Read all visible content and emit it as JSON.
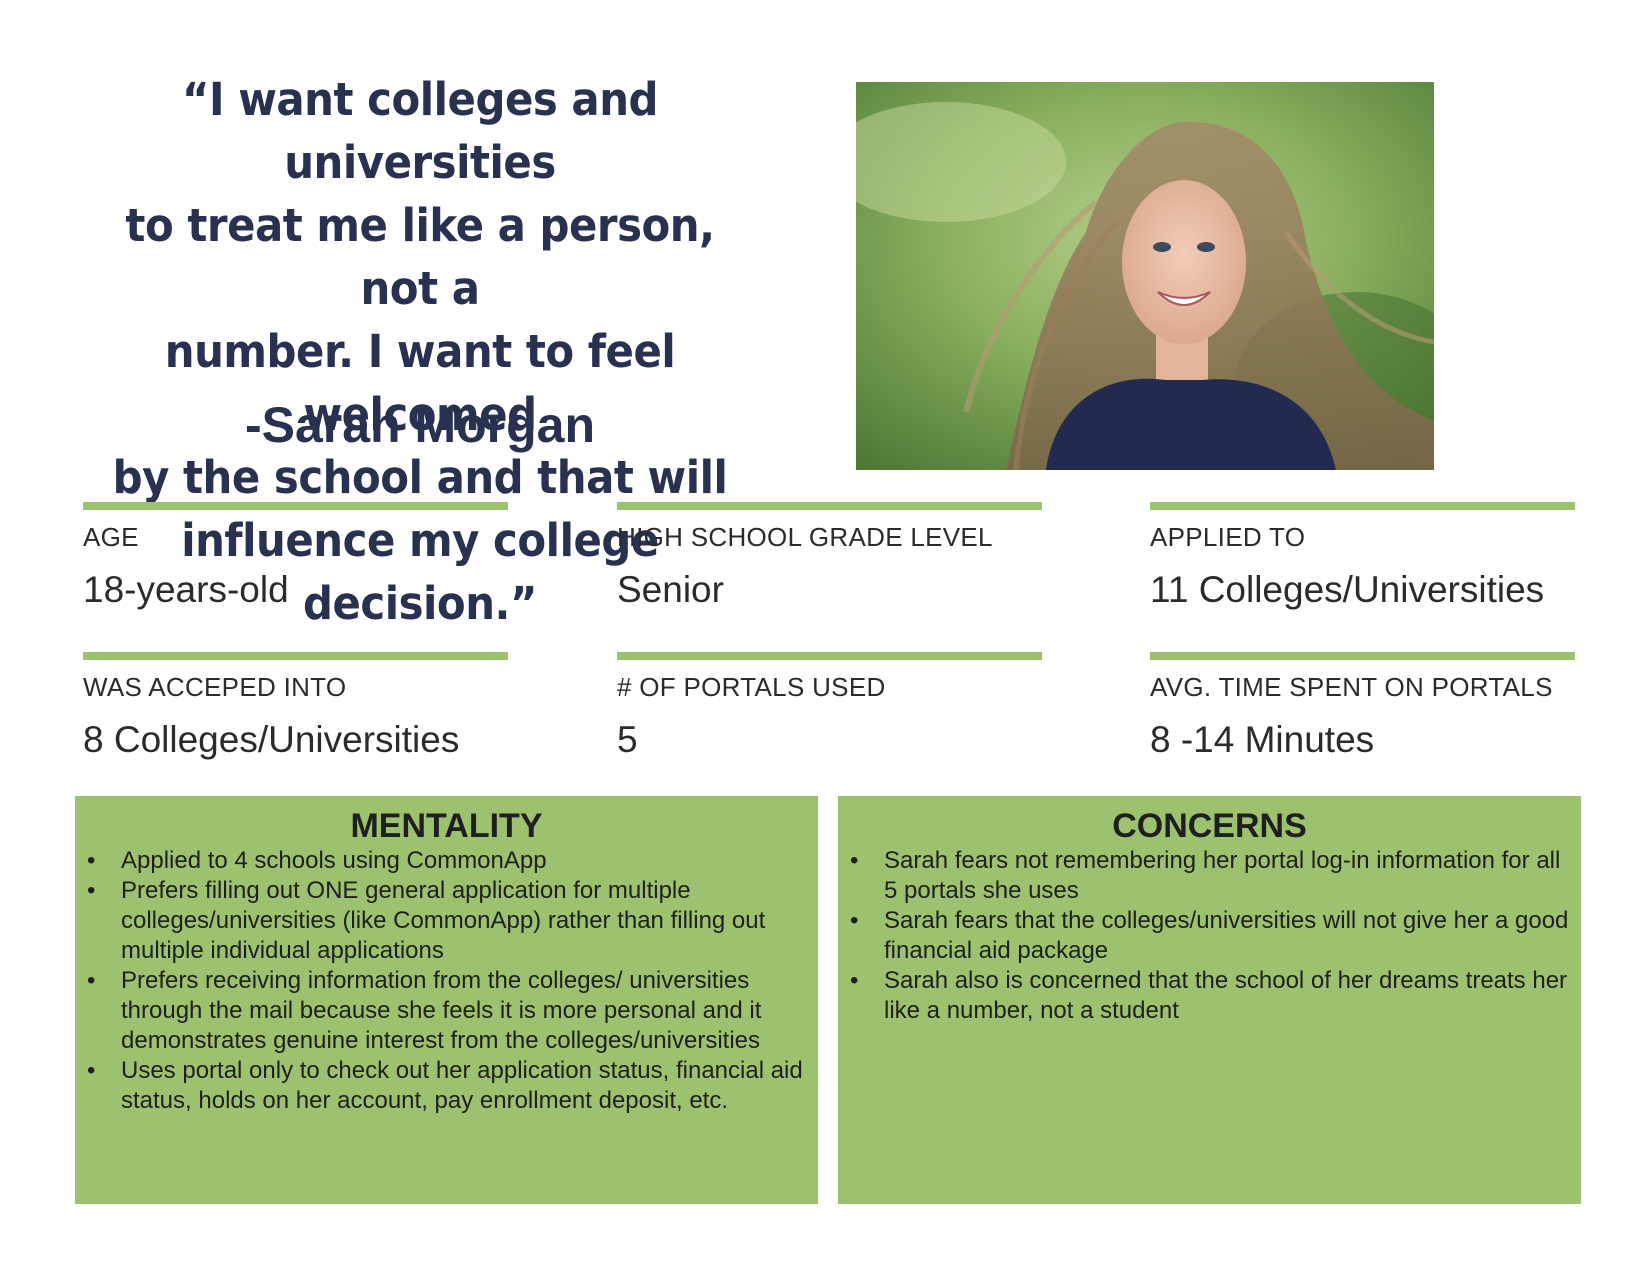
{
  "quote": {
    "lines": [
      "“I want colleges and universities",
      "to treat me like a person, not a",
      "number. I want to feel welcomed",
      "by the school and that will",
      "influence my college decision.”"
    ],
    "author": "-Sarah Morgan"
  },
  "photo": {
    "subject": "smiling teenage girl with long windblown hair, navy top, green blurred background"
  },
  "stats": [
    {
      "label": "AGE",
      "value": "18-years-old"
    },
    {
      "label": "HIGH SCHOOL GRADE LEVEL",
      "value": "Senior"
    },
    {
      "label": "APPLIED TO",
      "value": "11 Colleges/Universities"
    },
    {
      "label": "WAS ACCEPED INTO",
      "value": "8 Colleges/Universities"
    },
    {
      "label": "# OF PORTALS USED",
      "value": "5"
    },
    {
      "label": "AVG. TIME SPENT ON PORTALS",
      "value": "8 -14 Minutes"
    }
  ],
  "mentality": {
    "title": "MENTALITY",
    "items": [
      "Applied to 4 schools using CommonApp",
      "Prefers filling out ONE general application for multiple colleges/universities (like CommonApp) rather than filling out multiple individual applications",
      "Prefers receiving information from the colleges/ universities through the mail because she feels it is more personal and it demonstrates genuine interest from the colleges/universities",
      "Uses portal only to check out her application status, financial aid status, holds on her account, pay enrollment deposit, etc."
    ]
  },
  "concerns": {
    "title": "CONCERNS",
    "items": [
      "Sarah fears not remembering her portal log-in information for all 5 portals she uses",
      "Sarah fears that the colleges/universities will not give her a good financial aid package",
      "Sarah also is concerned that the school of her dreams treats her like a number, not a student"
    ]
  },
  "colors": {
    "accent_green": "#9dc26f",
    "quote_navy": "#283150",
    "text": "#2b2b2b"
  }
}
